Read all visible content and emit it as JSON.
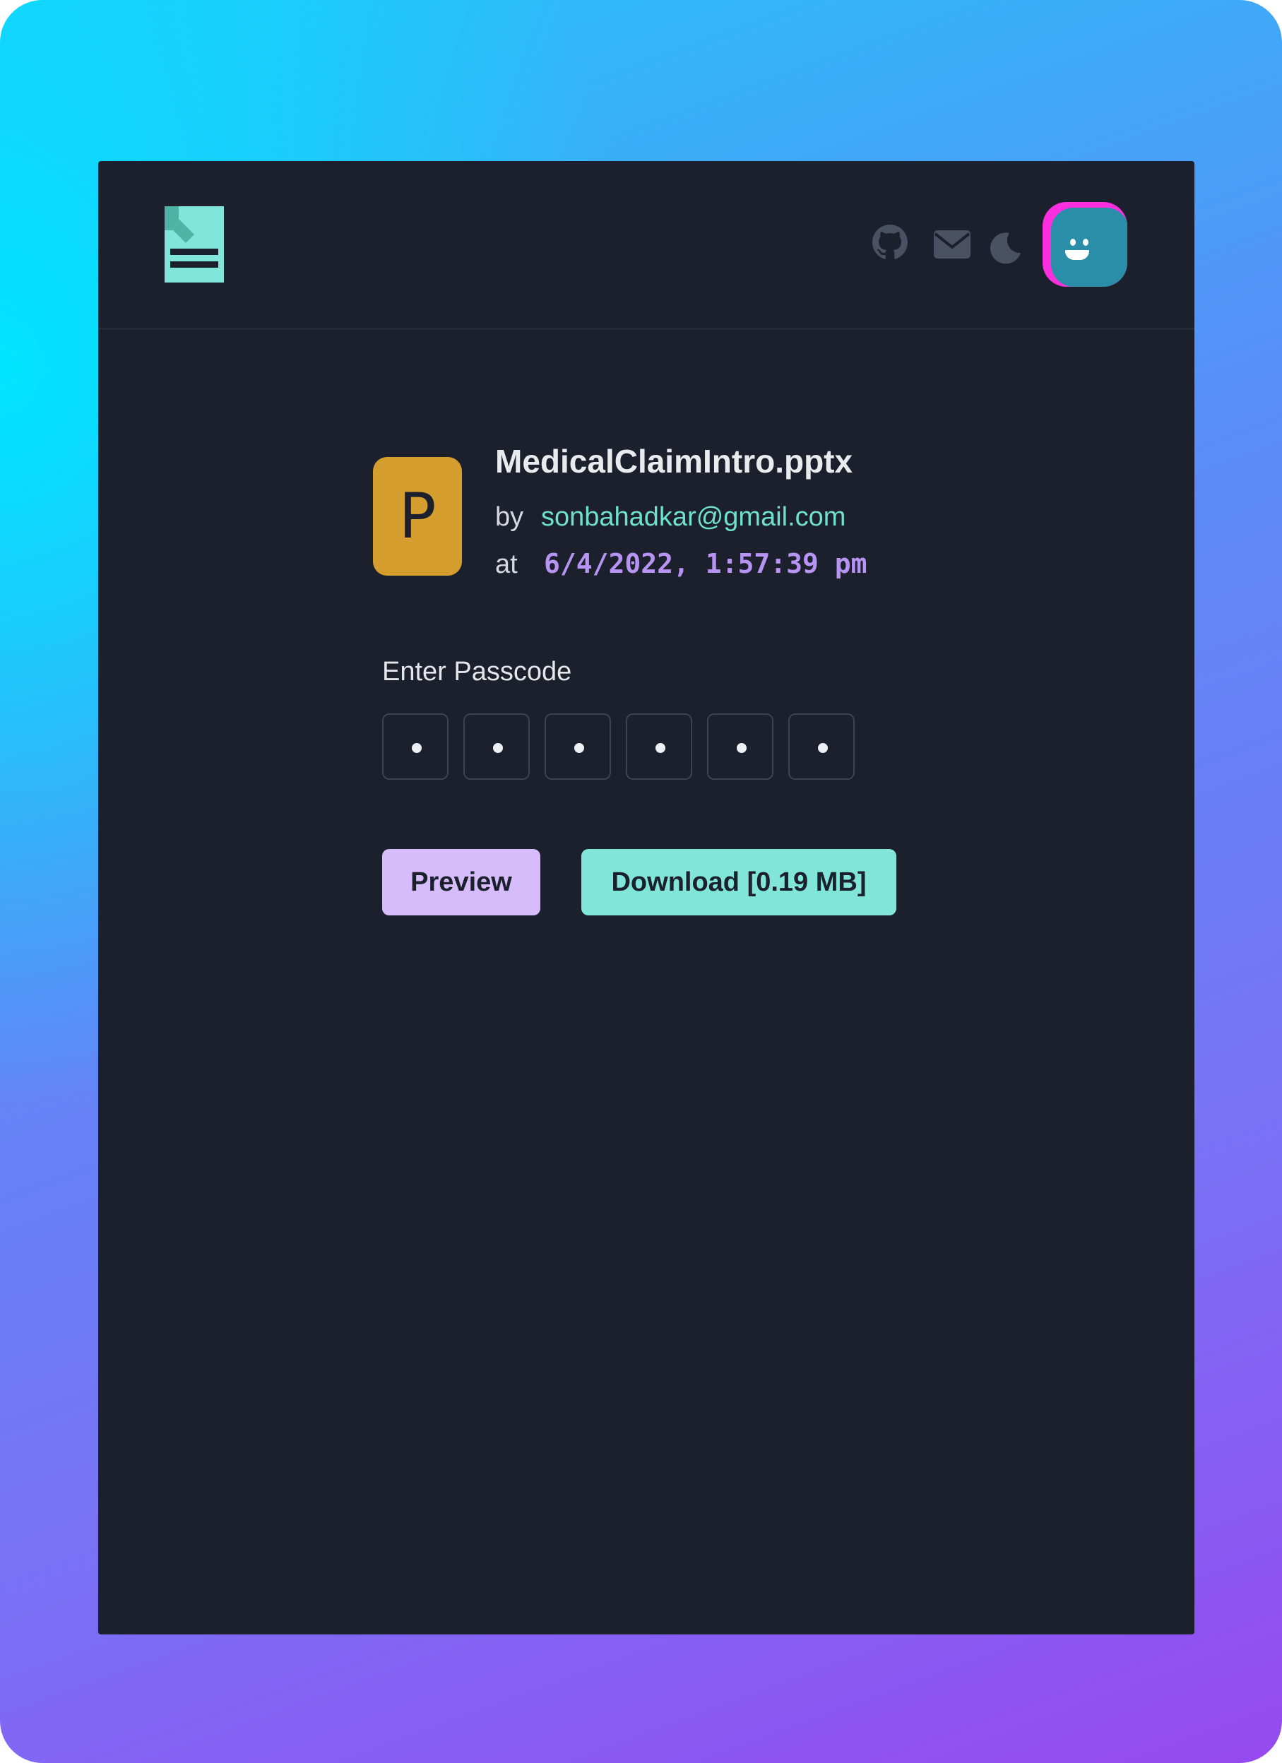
{
  "header": {
    "icons": [
      "file-download-logo-icon",
      "github-icon",
      "mail-icon",
      "moon-icon",
      "avatar"
    ],
    "colors": {
      "logo": "#81e6d9",
      "icons": "#4a5162",
      "avatar_bg": "#ff2fe0",
      "avatar_face": "#2a8ea8"
    }
  },
  "file": {
    "type_letter": "P",
    "name": "MedicalClaimIntro.pptx",
    "by_label": "by",
    "owner": "sonbahadkar@gmail.com",
    "at_label": "at",
    "timestamp": "6/4/2022, 1:57:39 pm",
    "tile_color": "#d69e2e"
  },
  "passcode": {
    "label": "Enter Passcode",
    "digits": [
      "•",
      "•",
      "•",
      "•",
      "•",
      "•"
    ]
  },
  "actions": {
    "preview_label": "Preview",
    "download_label": "Download [0.19 MB]",
    "preview_color": "#d6bcfa",
    "download_color": "#81e6d9"
  },
  "theme": {
    "page_bg": "#1b202c",
    "accent_teal": "#6ee0cd",
    "accent_purple": "#b794f4"
  }
}
